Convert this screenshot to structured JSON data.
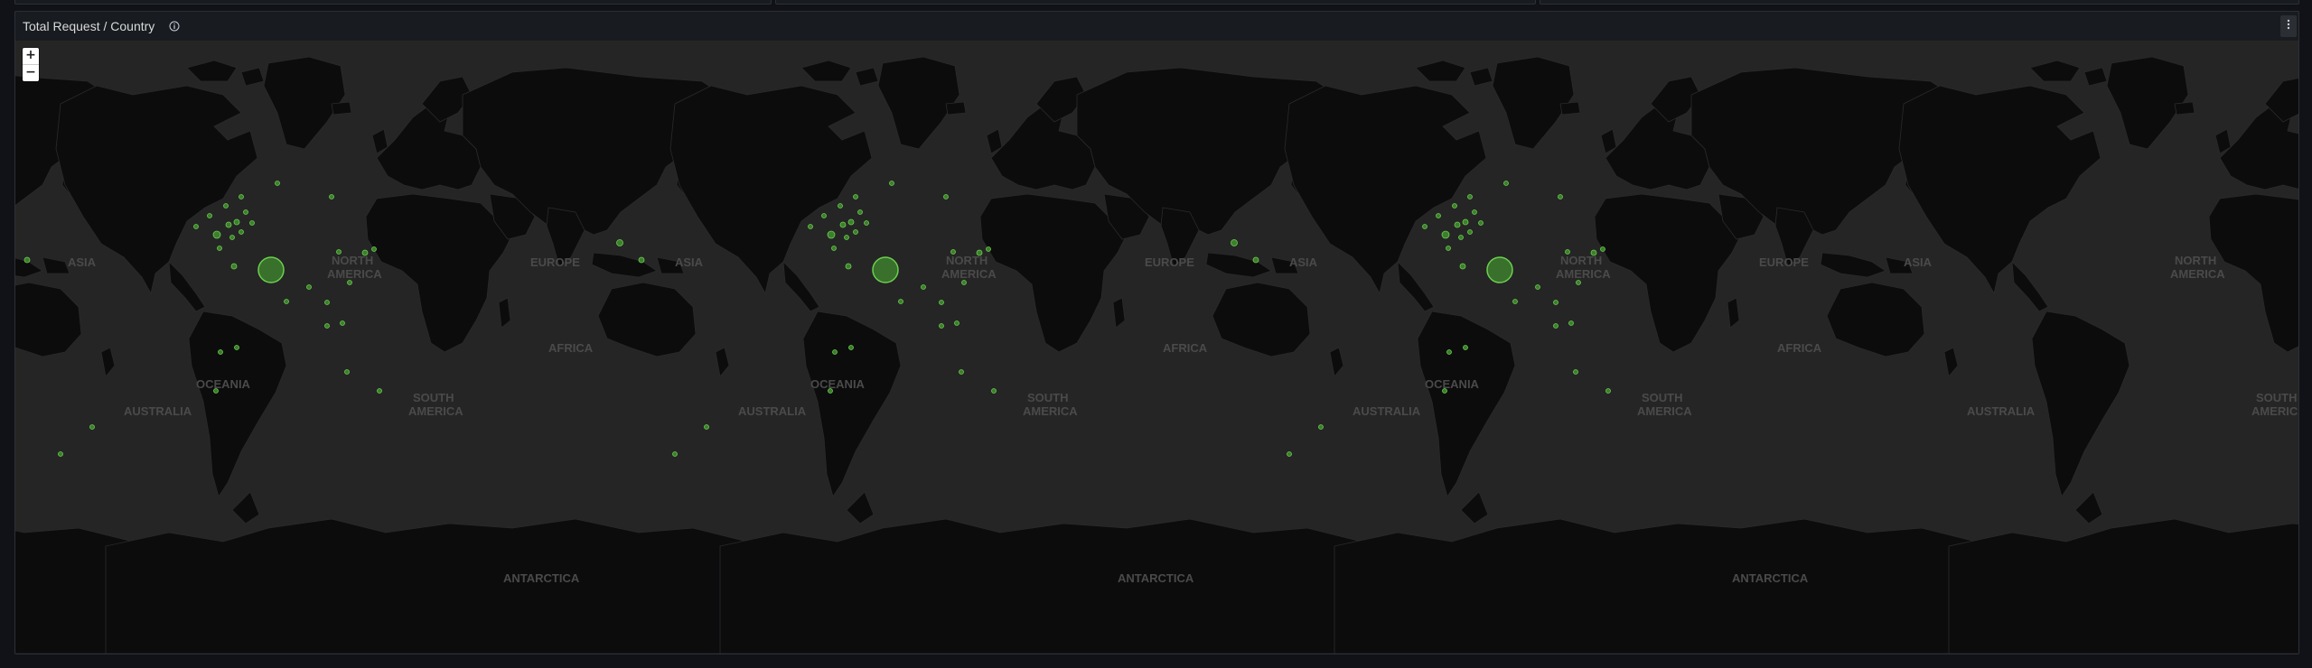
{
  "panel": {
    "title": "Total Request / Country",
    "info_icon": "info-circle-icon",
    "menu_icon": "kebab-menu-icon"
  },
  "zoom": {
    "in_label": "+",
    "out_label": "−"
  },
  "map": {
    "region_labels": [
      "ASIA",
      "NORTH AMERICA",
      "EUROPE",
      "AFRICA",
      "OCEANIA",
      "AUSTRALIA",
      "SOUTH AMERICA",
      "ANTARCTICA"
    ],
    "colors": {
      "ocean": "#252525",
      "land": "#0c0c0d",
      "marker_fill": "#3f8a2f",
      "marker_stroke": "#6ccf4e"
    }
  }
}
